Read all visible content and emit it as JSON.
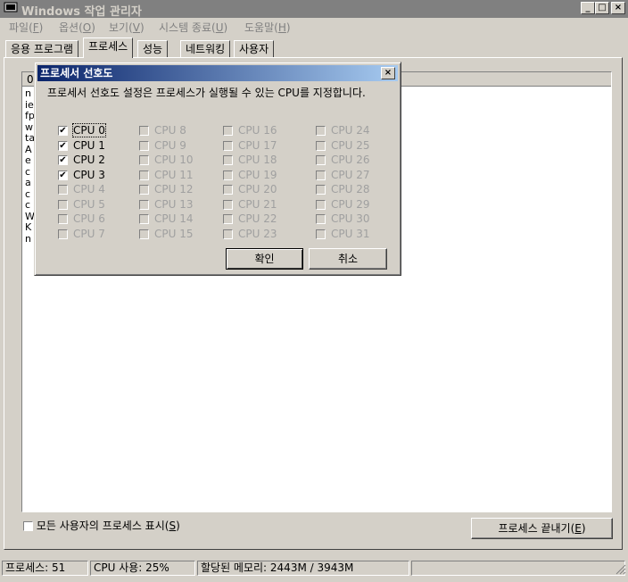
{
  "window": {
    "title": "Windows 작업 관리자",
    "caption_buttons": {
      "minimize": "_",
      "maximize": "□",
      "close": "×"
    }
  },
  "menu": [
    {
      "label": "파일(",
      "key": "F",
      "end": ")"
    },
    {
      "label": "옵션(",
      "key": "O",
      "end": ")"
    },
    {
      "label": "보기(",
      "key": "V",
      "end": ")"
    },
    {
      "label": "시스템 종료(",
      "key": "U",
      "end": ")"
    },
    {
      "label": "도움말(",
      "key": "H",
      "end": ")"
    }
  ],
  "tabs": [
    "응용 프로그램",
    "프로세스",
    "성능",
    "네트워킹",
    "사용자"
  ],
  "active_tab": "프로세스",
  "process_list": {
    "header_first_char": "0",
    "row_initials": [
      "n",
      "ie",
      "fp",
      "w",
      "ta",
      "A",
      "e",
      "c",
      "a",
      "c",
      "c",
      "W",
      "K",
      "n"
    ]
  },
  "show_all_users": {
    "label": "모든 사용자의 프로세스 표시(",
    "key": "S",
    "end": ")",
    "checked": false
  },
  "end_process_button": {
    "label": "프로세스 끝내기(",
    "key": "E",
    "end": ")"
  },
  "status": {
    "processes": "프로세스: 51",
    "cpu": "CPU 사용: 25%",
    "memory": "할당된 메모리: 2443M / 3943M"
  },
  "dialog": {
    "title": "프로세서 선호도",
    "close": "×",
    "description": "프로세서 선호도 설정은 프로세스가 실행될 수 있는 CPU를 지정합니다.",
    "cpus": [
      {
        "label": "CPU 0",
        "checked": true,
        "enabled": true
      },
      {
        "label": "CPU 1",
        "checked": true,
        "enabled": true
      },
      {
        "label": "CPU 2",
        "checked": true,
        "enabled": true
      },
      {
        "label": "CPU 3",
        "checked": true,
        "enabled": true
      },
      {
        "label": "CPU 4",
        "checked": false,
        "enabled": false
      },
      {
        "label": "CPU 5",
        "checked": false,
        "enabled": false
      },
      {
        "label": "CPU 6",
        "checked": false,
        "enabled": false
      },
      {
        "label": "CPU 7",
        "checked": false,
        "enabled": false
      },
      {
        "label": "CPU 8",
        "checked": false,
        "enabled": false
      },
      {
        "label": "CPU 9",
        "checked": false,
        "enabled": false
      },
      {
        "label": "CPU 10",
        "checked": false,
        "enabled": false
      },
      {
        "label": "CPU 11",
        "checked": false,
        "enabled": false
      },
      {
        "label": "CPU 12",
        "checked": false,
        "enabled": false
      },
      {
        "label": "CPU 13",
        "checked": false,
        "enabled": false
      },
      {
        "label": "CPU 14",
        "checked": false,
        "enabled": false
      },
      {
        "label": "CPU 15",
        "checked": false,
        "enabled": false
      },
      {
        "label": "CPU 16",
        "checked": false,
        "enabled": false
      },
      {
        "label": "CPU 17",
        "checked": false,
        "enabled": false
      },
      {
        "label": "CPU 18",
        "checked": false,
        "enabled": false
      },
      {
        "label": "CPU 19",
        "checked": false,
        "enabled": false
      },
      {
        "label": "CPU 20",
        "checked": false,
        "enabled": false
      },
      {
        "label": "CPU 21",
        "checked": false,
        "enabled": false
      },
      {
        "label": "CPU 22",
        "checked": false,
        "enabled": false
      },
      {
        "label": "CPU 23",
        "checked": false,
        "enabled": false
      },
      {
        "label": "CPU 24",
        "checked": false,
        "enabled": false
      },
      {
        "label": "CPU 25",
        "checked": false,
        "enabled": false
      },
      {
        "label": "CPU 26",
        "checked": false,
        "enabled": false
      },
      {
        "label": "CPU 27",
        "checked": false,
        "enabled": false
      },
      {
        "label": "CPU 28",
        "checked": false,
        "enabled": false
      },
      {
        "label": "CPU 29",
        "checked": false,
        "enabled": false
      },
      {
        "label": "CPU 30",
        "checked": false,
        "enabled": false
      },
      {
        "label": "CPU 31",
        "checked": false,
        "enabled": false
      }
    ],
    "ok_label": "확인",
    "cancel_label": "취소"
  }
}
